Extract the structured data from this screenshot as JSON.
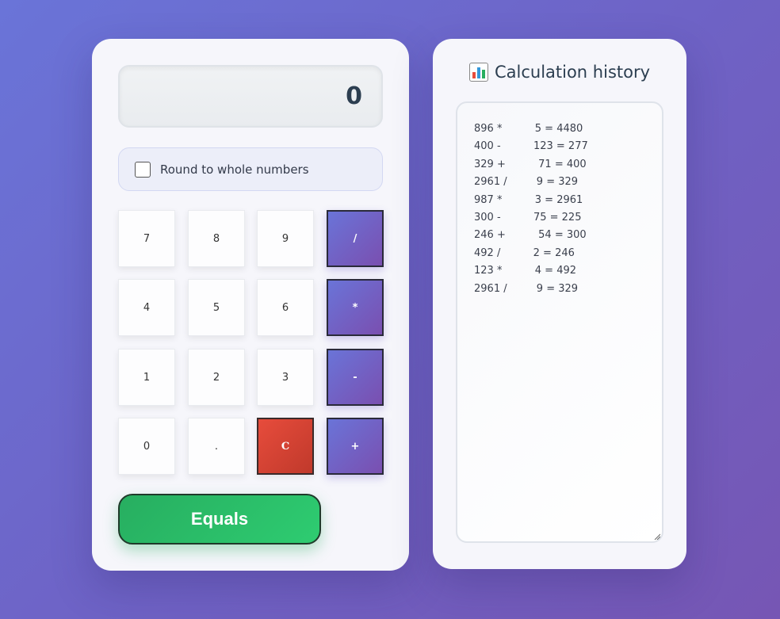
{
  "calculator": {
    "display_value": "0",
    "round_label": "Round to whole numbers",
    "round_checked": false,
    "keys": [
      {
        "label": "7",
        "type": "digit"
      },
      {
        "label": "8",
        "type": "digit"
      },
      {
        "label": "9",
        "type": "digit"
      },
      {
        "label": "/",
        "type": "op"
      },
      {
        "label": "4",
        "type": "digit"
      },
      {
        "label": "5",
        "type": "digit"
      },
      {
        "label": "6",
        "type": "digit"
      },
      {
        "label": "*",
        "type": "op"
      },
      {
        "label": "1",
        "type": "digit"
      },
      {
        "label": "2",
        "type": "digit"
      },
      {
        "label": "3",
        "type": "digit"
      },
      {
        "label": "-",
        "type": "op"
      },
      {
        "label": "0",
        "type": "digit"
      },
      {
        "label": ".",
        "type": "digit"
      },
      {
        "label": "C",
        "type": "clear"
      },
      {
        "label": "+",
        "type": "op"
      }
    ],
    "equals_label": "Equals"
  },
  "history": {
    "icon": "bar-chart-icon",
    "title": "Calculation history",
    "entries": [
      "896 *          5 = 4480",
      "400 -          123 = 277",
      "329 +          71 = 400",
      "2961 /         9 = 329",
      "987 *          3 = 2961",
      "300 -          75 = 225",
      "246 +          54 = 300",
      "492 /          2 = 246",
      "123 *          4 = 492",
      "2961 /         9 = 329"
    ]
  },
  "colors": {
    "accent": "#6a74d8",
    "clear": "#e74c3c",
    "equals": "#2ecc71"
  }
}
